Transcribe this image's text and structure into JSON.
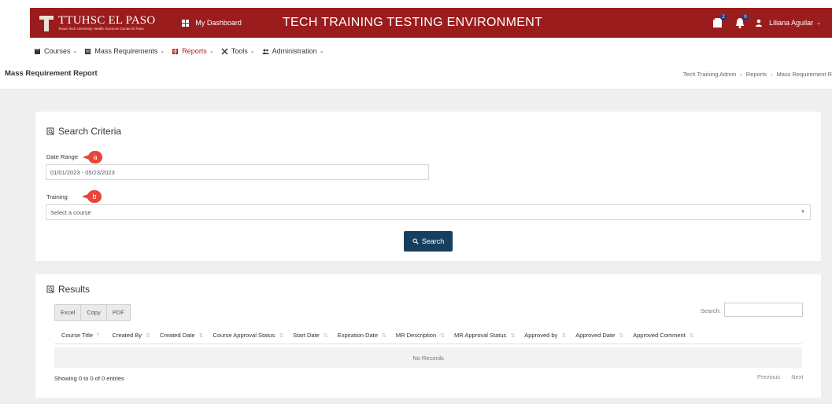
{
  "topbar": {
    "logo_title": "TTUHSC EL PASO",
    "logo_sub": "Texas Tech University Health Sciences Center El Paso",
    "dashboard_label": "My Dashboard",
    "app_title": "TECH TRAINING TESTING ENVIRONMENT",
    "messages_badge": "2",
    "notifications_badge": "0",
    "user_name": "Liliana Aguilar"
  },
  "menu": [
    {
      "label": "Courses",
      "icon": "book-icon"
    },
    {
      "label": "Mass Requirements",
      "icon": "list-icon"
    },
    {
      "label": "Reports",
      "icon": "report-icon",
      "active": true
    },
    {
      "label": "Tools",
      "icon": "tools-icon"
    },
    {
      "label": "Administration",
      "icon": "people-icon"
    }
  ],
  "page": {
    "title": "Mass Requirement Report",
    "breadcrumb": [
      "Tech Training Admin",
      "Reports",
      "Mass Requirement R"
    ]
  },
  "search_card": {
    "heading": "Search Criteria",
    "date_label": "Date Range",
    "date_value": "01/01/2023 - 05/23/2023",
    "training_label": "Training",
    "training_value": "Select a course",
    "callout_a": "a",
    "callout_b": "b",
    "search_button": "Search"
  },
  "results_card": {
    "heading": "Results",
    "export_buttons": [
      "Excel",
      "Copy",
      "PDF"
    ],
    "search_label": "Search:",
    "columns": [
      "Course Title",
      "Created By",
      "Created Date",
      "Course Approval Status",
      "Start Date",
      "Expiration Date",
      "MR Description",
      "MR Approval Status",
      "Approved by",
      "Approved Date",
      "Approved Comment"
    ],
    "empty_text": "No Records",
    "info": "Showing 0 to 0 of 0 entries",
    "prev_label": "Previous",
    "next_label": "Next"
  },
  "colors": {
    "topbar": "#9b1c1c",
    "accent_button": "#163f5f",
    "callout": "#e8453c",
    "active_menu": "#b02222"
  }
}
